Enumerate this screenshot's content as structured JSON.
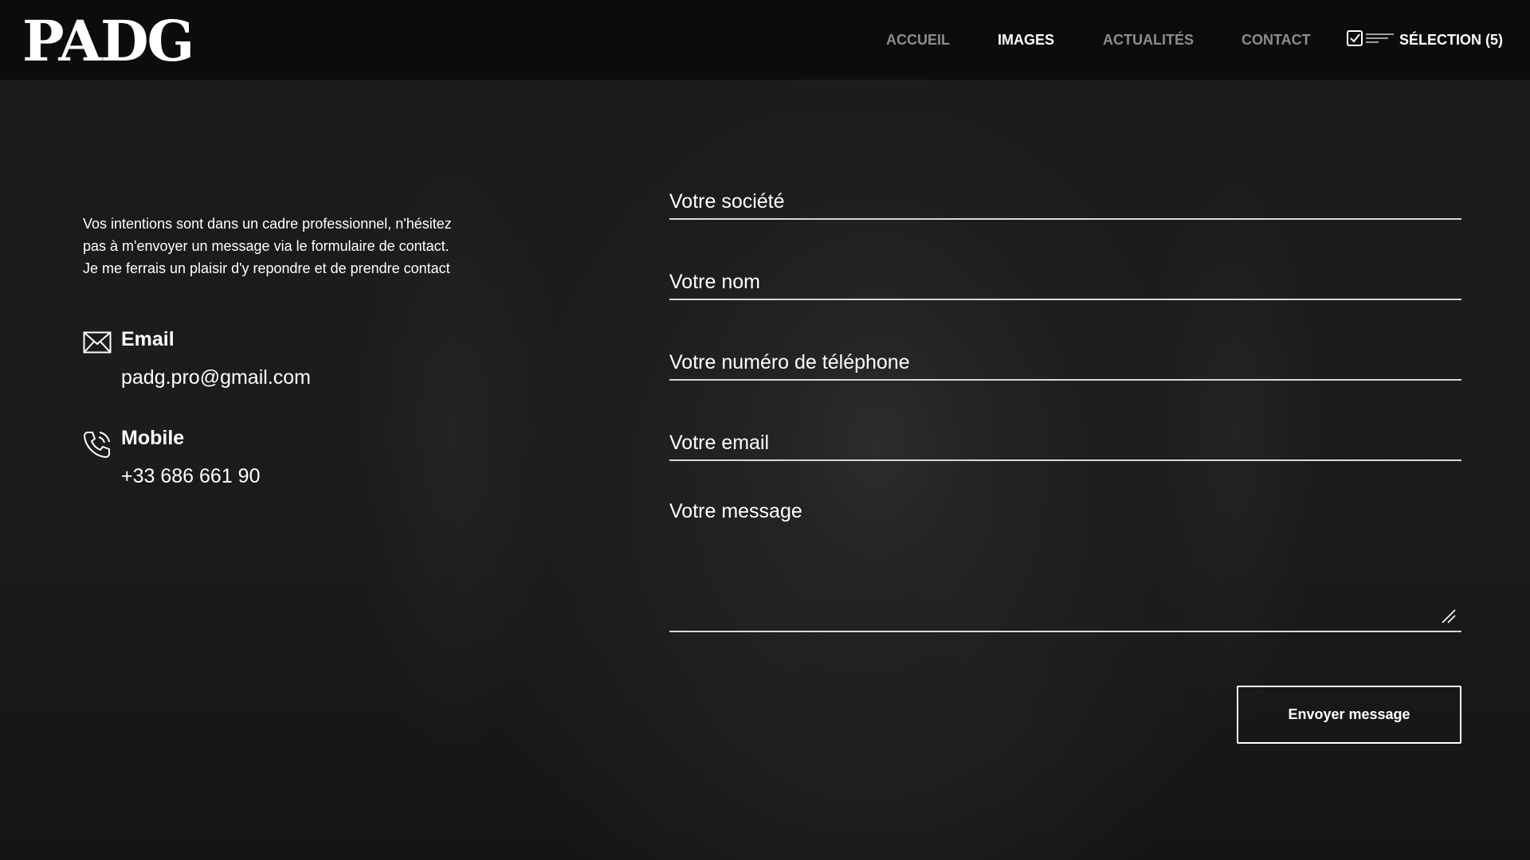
{
  "header": {
    "logo": "PADG",
    "nav": [
      {
        "label": "ACCUEIL",
        "active": false
      },
      {
        "label": "IMAGES",
        "active": true
      },
      {
        "label": "ACTUALITÉS",
        "active": false
      },
      {
        "label": "CONTACT",
        "active": false
      }
    ],
    "selection_label": "SÉLECTION (5)",
    "selection_icon": "checkbox-list-icon"
  },
  "info": {
    "intro_lines": [
      "Vos intentions sont dans un cadre professionnel, n'hésitez",
      "pas à m'envoyer un message via le formulaire de contact.",
      "Je me ferrais un plaisir d'y repondre et de prendre contact"
    ],
    "email": {
      "icon": "envelope-icon",
      "title": "Email",
      "value": "padg.pro@gmail.com"
    },
    "mobile": {
      "icon": "phone-icon",
      "title": "Mobile",
      "value": "+33 686 661 90"
    }
  },
  "form": {
    "company_placeholder": "Votre société",
    "name_placeholder": "Votre nom",
    "phone_placeholder": "Votre numéro de téléphone",
    "email_placeholder": "Votre email",
    "message_placeholder": "Votre message",
    "submit_label": "Envoyer message"
  },
  "colors": {
    "header_bg": "#0c0c0c",
    "page_bg": "#181818",
    "nav_inactive": "#8d8d8d",
    "text": "#ffffff"
  }
}
